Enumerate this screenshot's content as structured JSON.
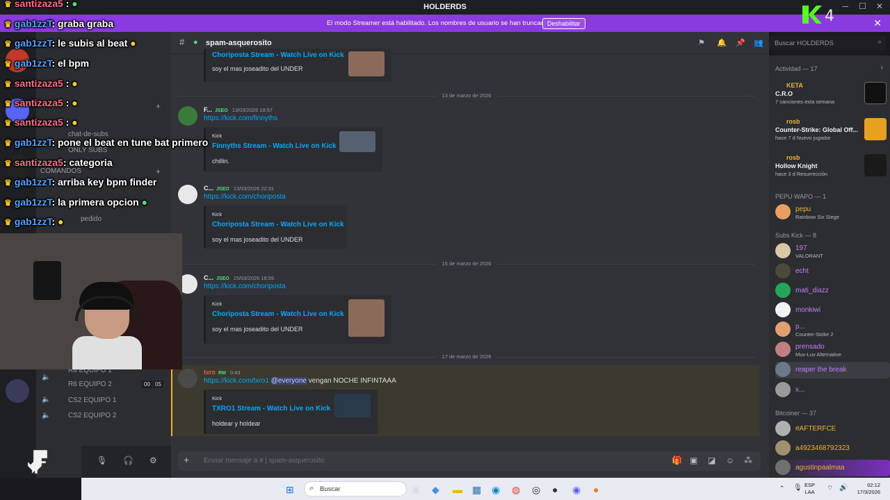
{
  "window": {
    "title": "HOLDERDS"
  },
  "banner": {
    "message": "El modo Streamer está habilitado. Los nombres de usuario se han truncado.",
    "button": "Deshabilitar"
  },
  "channel": {
    "name": "spam-asquerosito"
  },
  "search": {
    "placeholder": "Buscar HOLDERDS"
  },
  "sidebar": {
    "items": [
      "chat-de-subs",
      "ONLY SUBS",
      "COMANDOS",
      "pedido"
    ],
    "voice": [
      "R6 EQUIPO 1",
      "R6 EQUIPO 2",
      "CS2 EQUIPO 1",
      "CS2 EQUIPO 2"
    ],
    "voice_counts": [
      "00",
      "05"
    ]
  },
  "overlay_chat": [
    {
      "user": "santizaza5",
      "text": ":"
    },
    {
      "user": "gab1zzT",
      "text": ": graba graba"
    },
    {
      "user": "gab1zzT",
      "text": ": le subis al beat"
    },
    {
      "user": "gab1zzT",
      "text": ": el bpm"
    },
    {
      "user": "santizaza5",
      "text": ":"
    },
    {
      "user": "santizaza5",
      "text": ":"
    },
    {
      "user": "santizaza5",
      "text": ":"
    },
    {
      "user": "gab1zzT",
      "text": ": pone el beat en tune bat primero"
    },
    {
      "user": "santizaza5",
      "text": ": categoria"
    },
    {
      "user": "gab1zzT",
      "text": ": arriba key bpm finder"
    },
    {
      "user": "gab1zzT",
      "text": ": la primera opcion"
    },
    {
      "user": "gab1zzT",
      "text": ":"
    }
  ],
  "messages": {
    "top_embed": {
      "title": "Choriposta Stream - Watch Live on Kick",
      "desc": "soy el mas joseadito del UNDER"
    },
    "dates": [
      "13 de marzo de 2026",
      "15 de marzo de 2026",
      "17 de marzo de 2026"
    ],
    "m1": {
      "user": "F...",
      "tag": "JSEO",
      "time": "13/03/2026 18:57",
      "link": "https://kick.com/finnyths",
      "prov": "Kick",
      "title": "Finnyths Stream - Watch Live on Kick",
      "desc": "chillin."
    },
    "m2": {
      "user": "C...",
      "tag": "JSEO",
      "time": "13/03/2026 22:31",
      "link": "https://kick.com/choriposta",
      "prov": "Kick",
      "title": "Choriposta Stream - Watch Live on Kick",
      "desc": "soy el mas joseadito del UNDER"
    },
    "m3": {
      "user": "C...",
      "tag": "JSEO",
      "time": "15/03/2026 18:59",
      "link": "https://kick.com/choriposta",
      "prov": "Kick",
      "title": "Choriposta Stream - Watch Live on Kick",
      "desc": "soy el mas joseadito del UNDER"
    },
    "m4": {
      "user": "txro",
      "tag": "RM",
      "time": "0:43",
      "link": "https://kick.com/txro1",
      "mention": "@everyone",
      "text": "vengan NOCHE INFINTAAA",
      "prov": "Kick",
      "title": "TXRO1 Stream - Watch Live on Kick",
      "desc": "holdear y holdear"
    }
  },
  "composer": {
    "placeholder": "Enviar mensaje a #  | spam-asquerosito"
  },
  "members": {
    "activity_header": "Actividad — 17",
    "activity": [
      {
        "user": "KETA",
        "game": "C.R.O",
        "sub": "7 canciones esta semana"
      },
      {
        "user": "rosb",
        "game": "Counter-Strike: Global Off...",
        "sub": "hace 7 d   Nuevo jugador"
      },
      {
        "user": "rosb",
        "game": "Hollow Knight",
        "sub": "hace 3 d   Resurrección"
      }
    ],
    "groups": [
      {
        "header": "PEPU WAPO — 1",
        "members": [
          {
            "name": "pepu",
            "status": "Rainbow Six Siege",
            "color": "#f0b232"
          }
        ]
      },
      {
        "header": "Subs Kick — 8",
        "members": [
          {
            "name": "197",
            "status": "VALORANT",
            "color": "#c77dff"
          },
          {
            "name": "echt",
            "status": "",
            "color": "#c77dff"
          },
          {
            "name": "mati_diazz",
            "status": "",
            "color": "#c77dff"
          },
          {
            "name": "monkiwi",
            "status": "",
            "color": "#c77dff"
          },
          {
            "name": "p...",
            "status": "Counter-Strike 2",
            "color": "#c77dff"
          },
          {
            "name": "prensado",
            "status": "Muv-Luv Alternative",
            "color": "#c77dff"
          },
          {
            "name": "reaper the break",
            "status": "",
            "color": "#c77dff"
          },
          {
            "name": "x...",
            "status": "",
            "color": "#c77dff"
          }
        ]
      },
      {
        "header": "Bitcoiner — 37",
        "members": [
          {
            "name": "#AFTERFCE",
            "status": "",
            "color": "#f0b232"
          },
          {
            "name": "a4923468792323",
            "status": "",
            "color": "#f0b232"
          },
          {
            "name": "agustinpaalmaa",
            "status": "",
            "color": "#f0b232"
          }
        ]
      }
    ]
  },
  "taskbar": {
    "search": "Buscar",
    "lang": "ESP\nLAA",
    "time": "02:12",
    "date": "17/3/2026"
  },
  "colors": {
    "accent": "#8a3be0",
    "link": "#00a8fc",
    "bg": "#313338"
  }
}
